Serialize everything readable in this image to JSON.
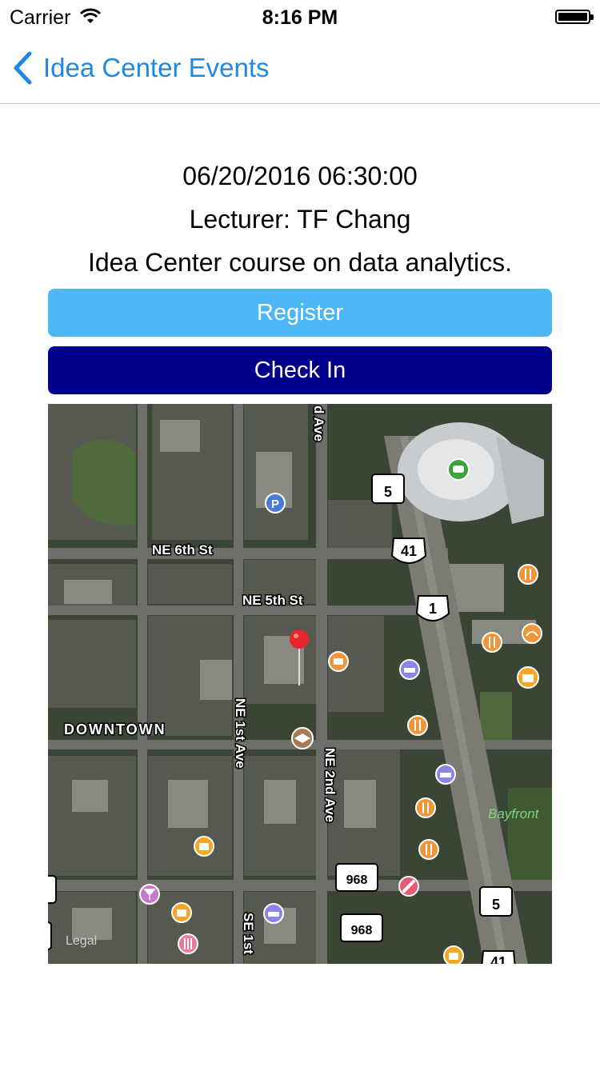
{
  "status_bar": {
    "carrier": "Carrier",
    "time": "8:16 PM"
  },
  "nav": {
    "back_label": "Idea Center Events"
  },
  "event": {
    "datetime": "06/20/2016 06:30:00",
    "lecturer": "Lecturer: TF Chang",
    "description": "Idea Center course on data analytics."
  },
  "buttons": {
    "register": "Register",
    "check_in": "Check In"
  },
  "map": {
    "labels": {
      "ne_6th": "NE 6th St",
      "ne_5th": "NE 5th St",
      "downtown": "DOWNTOWN",
      "ne_1st_ave": "NE 1st Ave",
      "ne_2nd_ave": "NE 2nd Ave",
      "d_ave": "d Ave",
      "se_1st": "SE 1st",
      "bayfront": "Bayfront",
      "legal": "Legal"
    },
    "route_shields": {
      "r5a": "5",
      "r41a": "41",
      "r1": "1",
      "r968a": "968",
      "r968b": "968",
      "r5b": "5",
      "r41b": "41"
    },
    "colors": {
      "pin": "#e8262b",
      "accent": "#1e88e5",
      "register": "#4db6f5",
      "check_in": "#00008b"
    }
  }
}
